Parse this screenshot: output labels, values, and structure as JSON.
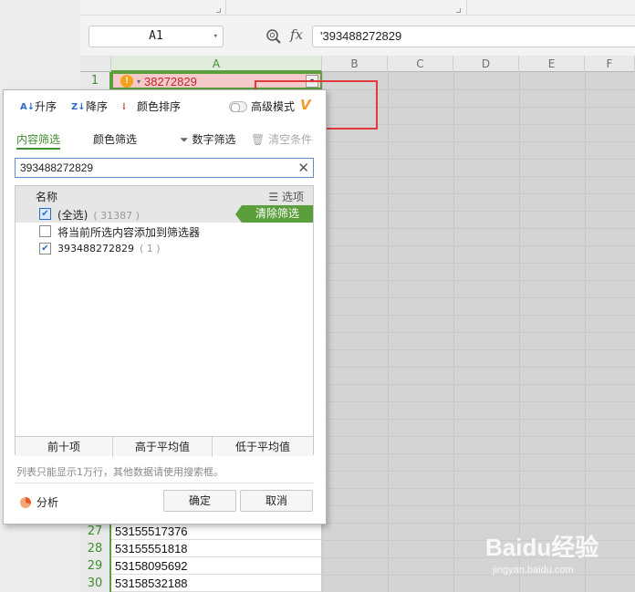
{
  "formula_bar": {
    "name_box": "A1",
    "fx_label": "fx",
    "formula_value": "'393488272829"
  },
  "sheet": {
    "columns": [
      "A",
      "B",
      "C",
      "D",
      "E",
      "F"
    ],
    "a1_text": "38272829",
    "rows": [
      {
        "num": "1"
      },
      {
        "num": "27",
        "value": "53155517376"
      },
      {
        "num": "28",
        "value": "53155551818"
      },
      {
        "num": "29",
        "value": "53158095692"
      },
      {
        "num": "30",
        "value": "53158532188"
      }
    ]
  },
  "filter_popup": {
    "sort_asc": "升序",
    "sort_desc": "降序",
    "sort_color": "颜色排序",
    "advanced_mode": "高级模式",
    "tab_content": "内容筛选",
    "tab_color": "颜色筛选",
    "number_filter": "数字筛选",
    "clear_conditions": "清空条件",
    "search_value": "393488272829",
    "list_header_name": "名称",
    "list_header_options": "选项",
    "items": [
      {
        "label": "(全选)",
        "count": "( 31387 )"
      },
      {
        "label": "将当前所选内容添加到筛选器",
        "count": ""
      },
      {
        "label": "393488272829",
        "count": "( 1 )"
      }
    ],
    "clear_filter": "清除筛选",
    "quick_buttons": [
      "前十项",
      "高于平均值",
      "低于平均值"
    ],
    "note": "列表只能显示1万行，其他数据请使用搜索框。",
    "analysis": "分析",
    "ok": "确定",
    "cancel": "取消"
  },
  "watermark": {
    "brand": "Baidu经验",
    "url": "jingyan.baidu.com"
  },
  "colors": {
    "accent_green": "#5b9e3c",
    "error_fill": "#f6c9cb",
    "error_text": "#c0262c",
    "highlight_box": "#e23a3a"
  }
}
